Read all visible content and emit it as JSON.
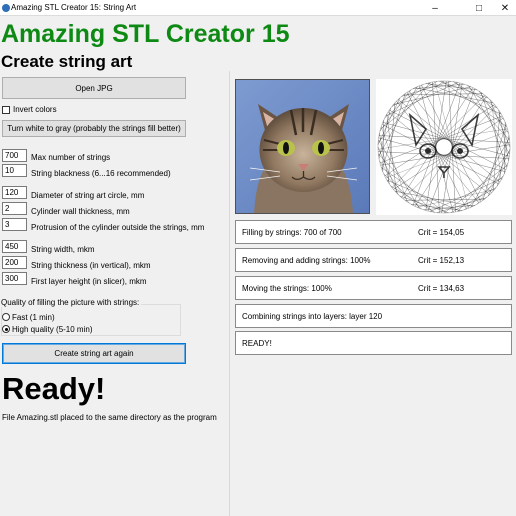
{
  "window": {
    "title": "Amazing STL Creator 15: String Art"
  },
  "header": {
    "app_name": "Amazing STL Creator 15",
    "subtitle": "Create string art"
  },
  "controls": {
    "open_label": "Open JPG",
    "invert_label": "Invert colors",
    "invert_checked": false,
    "gray_label": "Turn white to gray (probably the strings fill better)",
    "fields": [
      {
        "value": "700",
        "label": "Max number of strings"
      },
      {
        "value": "10",
        "label": "String blackness (6...16 recommended)"
      },
      {
        "value": "120",
        "label": "Diameter of string art circle, mm"
      },
      {
        "value": "2",
        "label": "Cylinder wall thickness, mm"
      },
      {
        "value": "3",
        "label": "Protrusion of the cylinder outside the strings, mm"
      },
      {
        "value": "450",
        "label": "String width, mkm"
      },
      {
        "value": "200",
        "label": "String thickness (in vertical), mkm"
      },
      {
        "value": "300",
        "label": "First layer height (in slicer), mkm"
      }
    ],
    "quality": {
      "title": "Quality of filling the picture with strings:",
      "options": [
        {
          "label": "Fast (1 min)",
          "selected": false
        },
        {
          "label": "High quality (5-10 min)",
          "selected": true
        }
      ]
    },
    "create_label": "Create string art again",
    "ready_text": "Ready!",
    "file_note": "File Amazing.stl placed to the same directory as the program"
  },
  "status": [
    {
      "text": "Filling by strings: 700 of 700",
      "crit": "Crit = 154,05"
    },
    {
      "text": "Removing and adding strings: 100%",
      "crit": "Crit = 152,13"
    },
    {
      "text": "Moving the strings: 100%",
      "crit": "Crit = 134,63"
    },
    {
      "text": "Combining strings into layers: layer 120",
      "crit": ""
    },
    {
      "text": "READY!",
      "crit": ""
    }
  ],
  "icons": {
    "app": "app-icon",
    "minimize": "minimize-icon",
    "maximize": "maximize-icon",
    "close": "close-icon"
  },
  "colors": {
    "heading": "#0e8a14",
    "focus": "#0078d7"
  }
}
